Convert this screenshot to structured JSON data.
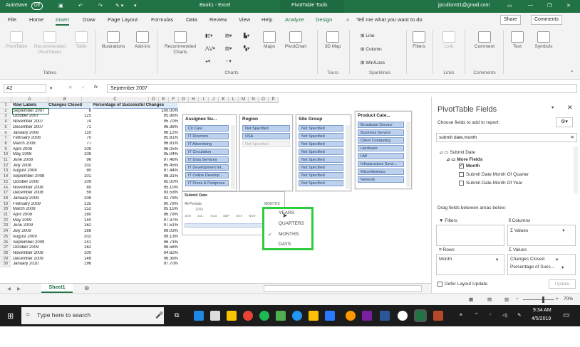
{
  "titlebar": {
    "autosave": "AutoSave",
    "autosave_state": "Off",
    "doc_title": "Book1  -  Excel",
    "context_tools": "PivotTable Tools",
    "user": "jpcullom01@gmail.com"
  },
  "tabs": [
    "File",
    "Home",
    "Insert",
    "Draw",
    "Page Layout",
    "Formulas",
    "Data",
    "Review",
    "View",
    "Help",
    "Analyze",
    "Design"
  ],
  "tell_me": "Tell me what you want to do",
  "share": "Share",
  "comments": "Comments",
  "ribbon": {
    "pivottable": "PivotTable",
    "recommended_pivottables": "Recommended PivotTables",
    "table": "Table",
    "tables_group": "Tables",
    "illustrations": "Illustrations",
    "addins": "Add-ins",
    "recommended_charts": "Recommended Charts",
    "maps": "Maps",
    "pivotchart": "PivotChart",
    "charts_group": "Charts",
    "map_3d": "3D Map",
    "tours_group": "Tours",
    "line": "Line",
    "column": "Column",
    "winloss": "Win/Loss",
    "sparklines_group": "Sparklines",
    "filters": "Filters",
    "link": "Link",
    "links_group": "Links",
    "comment": "Comment",
    "comments_group": "Comments",
    "text": "Text",
    "symbols": "Symbols"
  },
  "formula_bar": {
    "name_box": "A2",
    "value": "September 2007"
  },
  "columns": [
    "A",
    "B",
    "C",
    "D",
    "E",
    "F",
    "G",
    "H",
    "I",
    "J",
    "K",
    "L",
    "M",
    "N",
    "O",
    "P"
  ],
  "pivot_headers": [
    "Row Labels",
    "Changes Closed",
    "Percentage of Successful Changes"
  ],
  "pivot_rows": [
    [
      "September 2007",
      "6",
      "100.00%"
    ],
    [
      "October 2007",
      "125",
      "95.88%"
    ],
    [
      "November 2007",
      "74",
      "95.70%"
    ],
    [
      "December 2007",
      "71",
      "96.38%"
    ],
    [
      "January 2008",
      "110",
      "96.12%"
    ],
    [
      "February 2008",
      "70",
      "95.81%"
    ],
    [
      "March 2008",
      "77",
      "96.81%"
    ],
    [
      "April 2008",
      "109",
      "96.05%"
    ],
    [
      "May 2008",
      "109",
      "95.04%"
    ],
    [
      "June 2008",
      "96",
      "97.46%"
    ],
    [
      "July 2008",
      "102",
      "95.45%"
    ],
    [
      "August 2008",
      "90",
      "97.44%"
    ],
    [
      "September 2008",
      "101",
      "98.31%"
    ],
    [
      "October 2008",
      "109",
      "95.00%"
    ],
    [
      "November 2008",
      "80",
      "95.10%"
    ],
    [
      "December 2008",
      "59",
      "93.53%"
    ],
    [
      "January 2009",
      "108",
      "92.79%"
    ],
    [
      "February 2009",
      "135",
      "90.78%"
    ],
    [
      "March 2009",
      "152",
      "95.15%"
    ],
    [
      "April 2009",
      "180",
      "96.79%"
    ],
    [
      "May 2009",
      "140",
      "97.37%"
    ],
    [
      "June 2009",
      "162",
      "97.51%"
    ],
    [
      "July 2009",
      "169",
      "99.03%"
    ],
    [
      "August 2009",
      "202",
      "99.13%"
    ],
    [
      "September 2009",
      "141",
      "96.73%"
    ],
    [
      "October 2009",
      "162",
      "98.58%"
    ],
    [
      "November 2009",
      "100",
      "94.62%"
    ],
    [
      "December 2009",
      "149",
      "96.39%"
    ],
    [
      "January 2010",
      "196",
      "97.70%"
    ]
  ],
  "slicers": [
    {
      "title": "Assignee Su...",
      "items": [
        "Cit Care",
        "IT Directors",
        "IT Advertising",
        "IT Circulation",
        "IT Data Services",
        "IT Development Int...",
        "IT Online Develop...",
        "IT Press & Postpress"
      ]
    },
    {
      "title": "Region",
      "items": [
        "Not Specified",
        "USA",
        "Not Specified"
      ]
    },
    {
      "title": "Site Group",
      "items": [
        "Not Specified",
        "Not Specified",
        "Not Specified",
        "Not Specified",
        "Not Specified",
        "Not Specified",
        "Not Specified",
        "Not Specified"
      ]
    },
    {
      "title": "Product Cate...",
      "items": [
        "Broadcast Service",
        "Business Service",
        "Client Computing",
        "Hardware",
        "HW",
        "Infrastructure Servi...",
        "Miscellaneous",
        "Network"
      ]
    }
  ],
  "timeline": {
    "title": "Submit Date",
    "all_periods": "All Periods",
    "level": "MONTHS",
    "year": "2009",
    "months": [
      "JUN",
      "JUL",
      "AUG",
      "SEP",
      "OCT",
      "NOV"
    ]
  },
  "timeline_dropdown": {
    "options": [
      "YEARS",
      "QUARTERS",
      "MONTHS",
      "DAYS"
    ],
    "selected": "MONTHS"
  },
  "sheet_tab": "Sheet1",
  "pivot_pane": {
    "title": "PivotTable Fields",
    "choose_label": "Choose fields to add to report:",
    "search_value": "submit date.month",
    "tree": [
      "Submit Date",
      "More Fields",
      "Month",
      "Submit Date.Month Of Quarter",
      "Submit Date.Month Of Year"
    ],
    "drag_label": "Drag fields between areas below:",
    "filters_label": "Filters",
    "columns_label": "Columns",
    "columns_value": "Σ  Values",
    "rows_label": "Rows",
    "rows_value": "Month",
    "values_label": "Values",
    "values_items": [
      "Changes Closed",
      "Percentage of Succ..."
    ],
    "defer_label": "Defer Layout Update",
    "update_label": "Update"
  },
  "statusbar": {
    "zoom": "70%"
  },
  "taskbar": {
    "search_placeholder": "Type here to search",
    "time": "9:34 AM",
    "date": "4/5/2019"
  },
  "colors": {
    "excel_green": "#217346",
    "highlight": "#2ecc40",
    "slicer_selected": "#bdd1ec"
  }
}
